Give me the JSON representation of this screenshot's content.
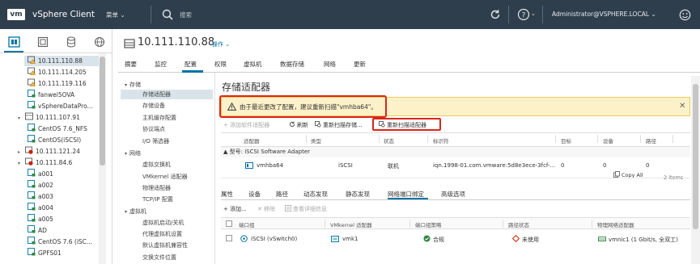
{
  "topbar": {
    "logo": "vm",
    "app_title": "vSphere Client",
    "menu": "菜单 ⌄",
    "search_placeholder": "搜索",
    "help_caret": "⌄",
    "user": "Administrator@VSPHERE.LOCAL ⌄"
  },
  "tree": {
    "items": [
      {
        "label": "10.111.110.88",
        "icon": "host-warning-icon",
        "indent": 2,
        "selected": true
      },
      {
        "label": "10.111.114.205",
        "icon": "host-warning-icon",
        "indent": 2
      },
      {
        "label": "10.111.119.116",
        "icon": "host-warning-icon",
        "indent": 2
      },
      {
        "label": "fanwei5OVA",
        "icon": "vm-icon",
        "indent": 2
      },
      {
        "label": "vSphereDataPro...",
        "icon": "vm-icon",
        "indent": 2
      },
      {
        "label": "10.111.107.91",
        "icon": "host-icon",
        "indent": 1,
        "toggle": "▾"
      },
      {
        "label": "CentOS 7.6_NFS",
        "icon": "vm-icon",
        "indent": 2
      },
      {
        "label": "CentOS(iSCSI)",
        "icon": "vm-icon",
        "indent": 2
      },
      {
        "label": "10.111.121.24",
        "icon": "host-error-icon",
        "indent": 1,
        "toggle": "▸"
      },
      {
        "label": "10.111.84.6",
        "icon": "host-error-icon",
        "indent": 1,
        "toggle": "▾"
      },
      {
        "label": "a001",
        "icon": "vm-icon",
        "indent": 2
      },
      {
        "label": "a002",
        "icon": "vm-icon",
        "indent": 2
      },
      {
        "label": "a003",
        "icon": "vm-icon",
        "indent": 2
      },
      {
        "label": "a004",
        "icon": "vm-icon",
        "indent": 2
      },
      {
        "label": "a005",
        "icon": "vm-icon",
        "indent": 2
      },
      {
        "label": "AD",
        "icon": "vm-icon",
        "indent": 2
      },
      {
        "label": "CentOS 7.6 (iSC...",
        "icon": "vm-icon",
        "indent": 2
      },
      {
        "label": "GPFS01",
        "icon": "vm-icon",
        "indent": 2
      }
    ]
  },
  "header": {
    "title": "10.111.110.88",
    "actions": "操作 ⌄"
  },
  "tabs": [
    "摘要",
    "监控",
    "配置",
    "权限",
    "虚拟机",
    "数据存储",
    "网络",
    "更新"
  ],
  "left_nav": {
    "sections": [
      {
        "label": "存储",
        "items": [
          "存储适配器",
          "存储设备",
          "主机缓存配置",
          "协议端点",
          "I/O 筛选器"
        ]
      },
      {
        "label": "网络",
        "items": [
          "虚拟交换机",
          "VMkernel 适配器",
          "物理适配器",
          "TCP/IP 配置"
        ]
      },
      {
        "label": "虚拟机",
        "items": [
          "虚拟机启动/关机",
          "代理虚拟机设置",
          "默认虚拟机兼容性",
          "交换文件位置"
        ]
      }
    ]
  },
  "page_title": "存储适配器",
  "alert": {
    "text": "由于最近更改了配置，建议重新扫描\"vmhba64\"。",
    "close": "✕"
  },
  "toolbar": {
    "add_software": "+ 添加软件适配器",
    "refresh": "刷新",
    "rescan_storage": "重新扫描存储...",
    "rescan_adapter": "重新扫描适配器"
  },
  "grid1": {
    "headers": [
      "适配器",
      "类型",
      "状态",
      "标识符",
      "目标",
      "设备",
      "路径"
    ],
    "group": "▲ 型号: iSCSI Software Adapter",
    "row": {
      "adapter": "vmhba64",
      "type": "iSCSI",
      "status": "联机",
      "identifier": "iqn.1998-01.com.vmware:5d8e3ece-3fcf-...",
      "targets": "0",
      "devices": "0",
      "paths": "0"
    },
    "copy_all": "Copy All",
    "items": "2 items"
  },
  "subtabs": [
    "属性",
    "设备",
    "路径",
    "动态发现",
    "静态发现",
    "网络端口绑定",
    "高级选项"
  ],
  "toolbar2": {
    "add": "+ 添加...",
    "remove": "✕ 移除",
    "details": "查看详细信息"
  },
  "grid2": {
    "headers": [
      "端口组",
      "VMkernel 适配器",
      "端口组策略",
      "路径状态",
      "物理网络适配器"
    ],
    "row": {
      "port_group": "iSCSI (vSwitch0)",
      "vmkernel": "vmk1",
      "policy": "合规",
      "path_status": "未使用",
      "physical": "vmnic1 (1 Gbit/s, 全双工)"
    }
  },
  "colors": {
    "topbar": "#2f3e4c",
    "accent": "#0072a3",
    "alert_bg": "#fdf1c9",
    "highlight_red": "#d9261c",
    "ok_green": "#2e8540",
    "warn_red": "#c92100"
  }
}
